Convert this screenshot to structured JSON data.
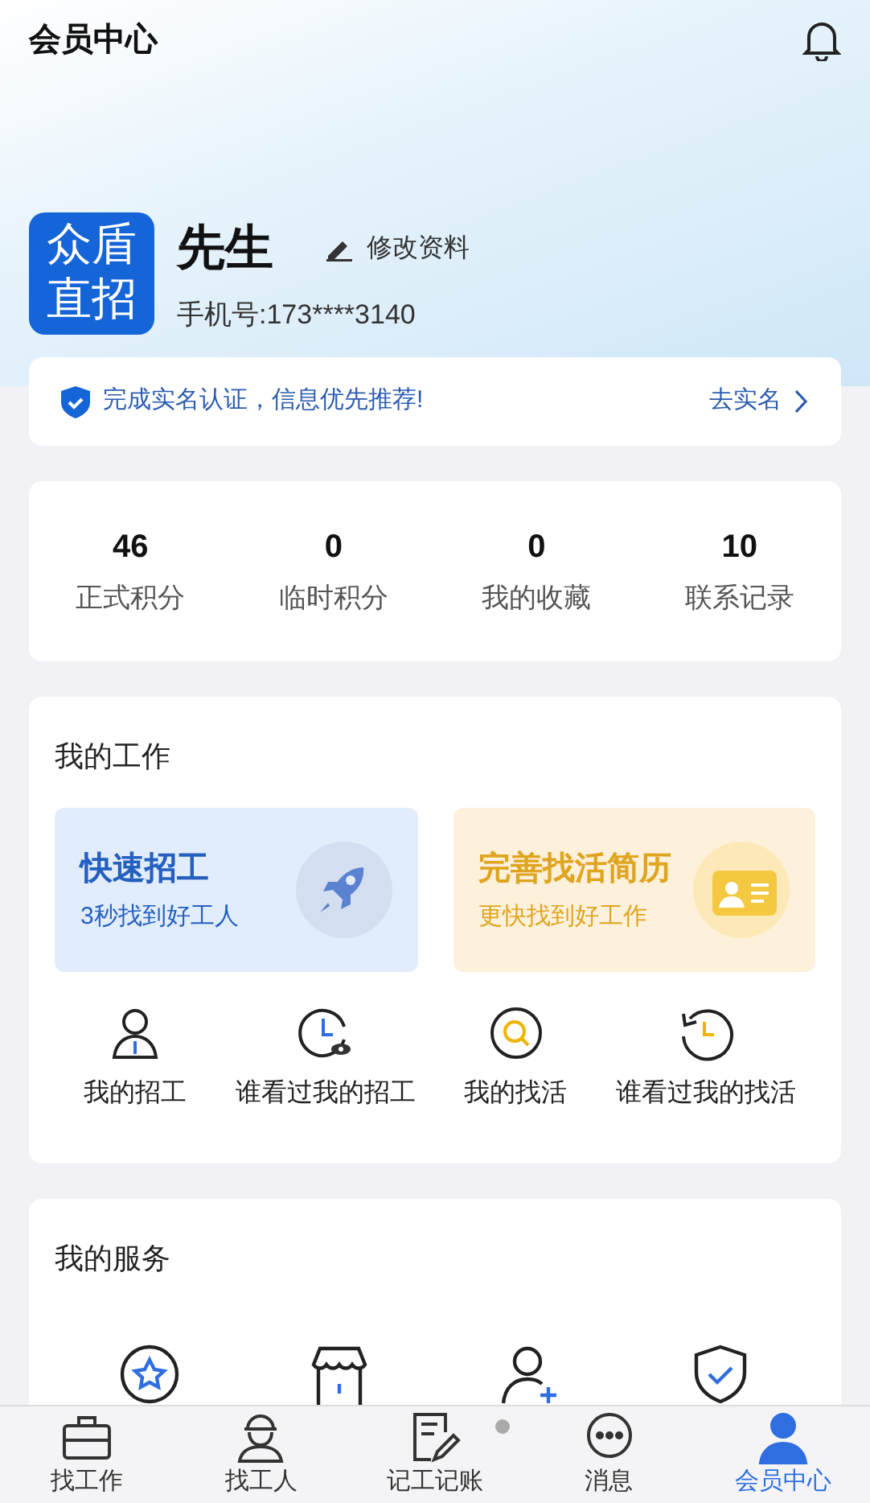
{
  "header": {
    "title": "会员中心"
  },
  "profile": {
    "logo_lines": [
      "众盾",
      "直招"
    ],
    "name": "先生",
    "edit_label": "修改资料",
    "phone": "手机号:173****3140"
  },
  "verify_banner": {
    "text": "完成实名认证，信息优先推荐!",
    "action": "去实名"
  },
  "stats": [
    {
      "value": "46",
      "label": "正式积分"
    },
    {
      "value": "0",
      "label": "临时积分"
    },
    {
      "value": "0",
      "label": "我的收藏"
    },
    {
      "value": "10",
      "label": "联系记录"
    }
  ],
  "my_work": {
    "title": "我的工作",
    "promos": [
      {
        "kind": "recruit",
        "title": "快速招工",
        "subtitle": "3秒找到好工人"
      },
      {
        "kind": "resume",
        "title": "完善找活简历",
        "subtitle": "更快找到好工作"
      }
    ],
    "shortcuts": [
      {
        "kind": "person",
        "label": "我的招工"
      },
      {
        "kind": "clock-eye",
        "label": "谁看过我的招工"
      },
      {
        "kind": "search",
        "label": "我的找活"
      },
      {
        "kind": "history",
        "label": "谁看过我的找活"
      }
    ]
  },
  "my_services": {
    "title": "我的服务",
    "items": [
      {
        "kind": "star"
      },
      {
        "kind": "shop"
      },
      {
        "kind": "add-user"
      },
      {
        "kind": "shield"
      }
    ]
  },
  "tab_bar": [
    {
      "kind": "briefcase",
      "label": "找工作",
      "selected": false,
      "badge": false
    },
    {
      "kind": "worker",
      "label": "找工人",
      "selected": false,
      "badge": false
    },
    {
      "kind": "note",
      "label": "记工记账",
      "selected": false,
      "badge": true
    },
    {
      "kind": "chat",
      "label": "消息",
      "selected": false,
      "badge": false
    },
    {
      "kind": "user",
      "label": "会员中心",
      "selected": true,
      "badge": false
    }
  ]
}
